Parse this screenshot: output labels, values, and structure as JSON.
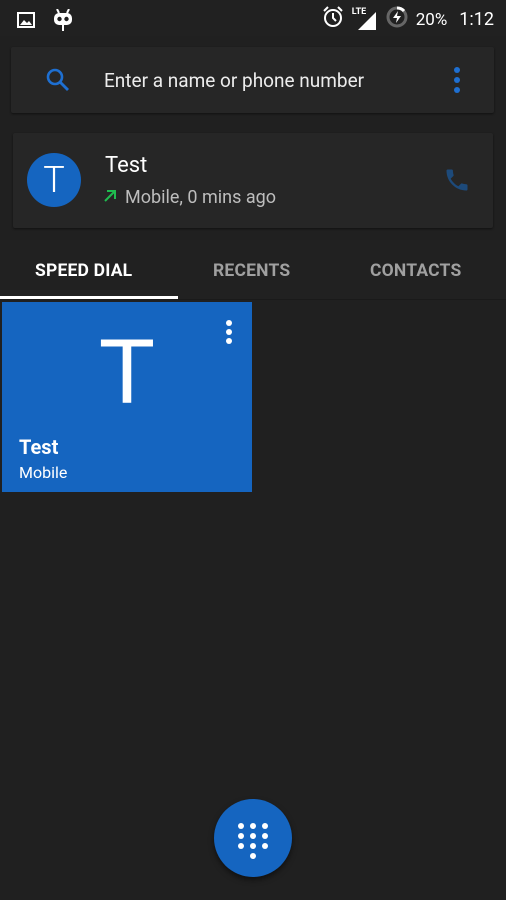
{
  "status_bar": {
    "left_icons": [
      "image-notification-icon",
      "cyanogenmod-notification-icon"
    ],
    "right_icons": [
      "alarm-icon",
      "lte-signal-icon",
      "battery-charging-icon"
    ],
    "network_label": "LTE",
    "battery_percent": "20%",
    "time": "1:12"
  },
  "search": {
    "placeholder": "Enter a name or phone number",
    "icon": "search-icon",
    "menu_icon": "more-vert-icon",
    "accent_color": "#1e6fd1"
  },
  "recent_call": {
    "avatar_letter": "T",
    "name": "Test",
    "call_type_icon": "outgoing-call-arrow-icon",
    "detail": "Mobile, 0 mins ago",
    "action_icon": "phone-icon"
  },
  "tabs": [
    {
      "label": "SPEED DIAL",
      "active": true
    },
    {
      "label": "RECENTS",
      "active": false
    },
    {
      "label": "CONTACTS",
      "active": false
    }
  ],
  "speed_dial": [
    {
      "letter": "T",
      "name": "Test",
      "type": "Mobile",
      "color": "#1565c0"
    }
  ],
  "fab": {
    "icon": "dialpad-icon",
    "color": "#1565c0"
  }
}
